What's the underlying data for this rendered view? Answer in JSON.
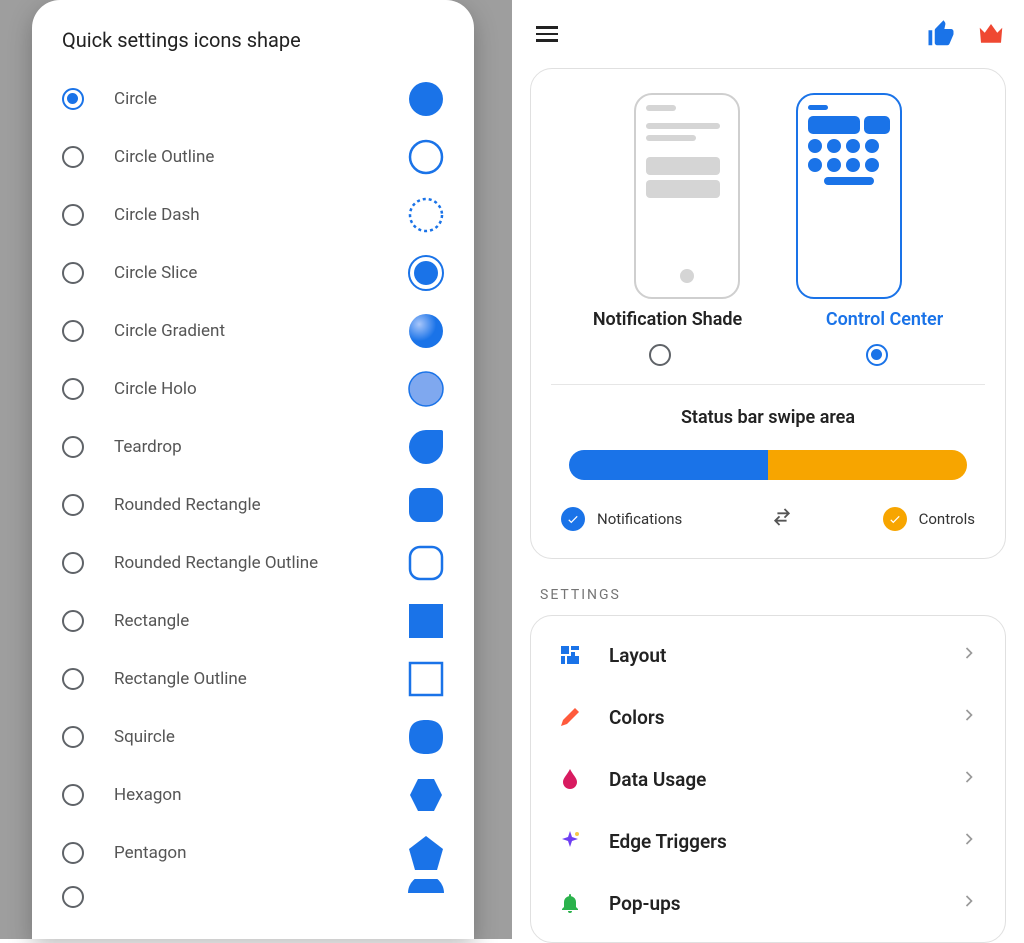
{
  "dialog": {
    "title": "Quick settings icons shape",
    "shapes": [
      {
        "label": "Circle",
        "selected": true
      },
      {
        "label": "Circle Outline"
      },
      {
        "label": "Circle Dash"
      },
      {
        "label": "Circle Slice"
      },
      {
        "label": "Circle Gradient"
      },
      {
        "label": "Circle Holo"
      },
      {
        "label": "Teardrop"
      },
      {
        "label": "Rounded Rectangle"
      },
      {
        "label": "Rounded Rectangle Outline"
      },
      {
        "label": "Rectangle"
      },
      {
        "label": "Rectangle Outline"
      },
      {
        "label": "Squircle"
      },
      {
        "label": "Hexagon"
      },
      {
        "label": "Pentagon"
      }
    ]
  },
  "settings": {
    "modes": {
      "left": {
        "label": "Notification Shade",
        "selected": false
      },
      "right": {
        "label": "Control Center",
        "selected": true
      }
    },
    "swipe_title": "Status bar swipe area",
    "swipe_legend": {
      "left": "Notifications",
      "right": "Controls"
    },
    "section_header": "SETTINGS",
    "items": [
      {
        "label": "Layout",
        "icon": "layout",
        "color": "#1a73e8"
      },
      {
        "label": "Colors",
        "icon": "colors",
        "color": "#ff5a3c"
      },
      {
        "label": "Data Usage",
        "icon": "drop",
        "color": "#d81b60"
      },
      {
        "label": "Edge Triggers",
        "icon": "sparkle",
        "color": "#6e3ff2"
      },
      {
        "label": "Pop-ups",
        "icon": "bell",
        "color": "#2bb24c"
      }
    ]
  },
  "colors": {
    "accent_blue": "#1a73e8",
    "accent_orange": "#f7a500",
    "crown": "#ef4832"
  }
}
